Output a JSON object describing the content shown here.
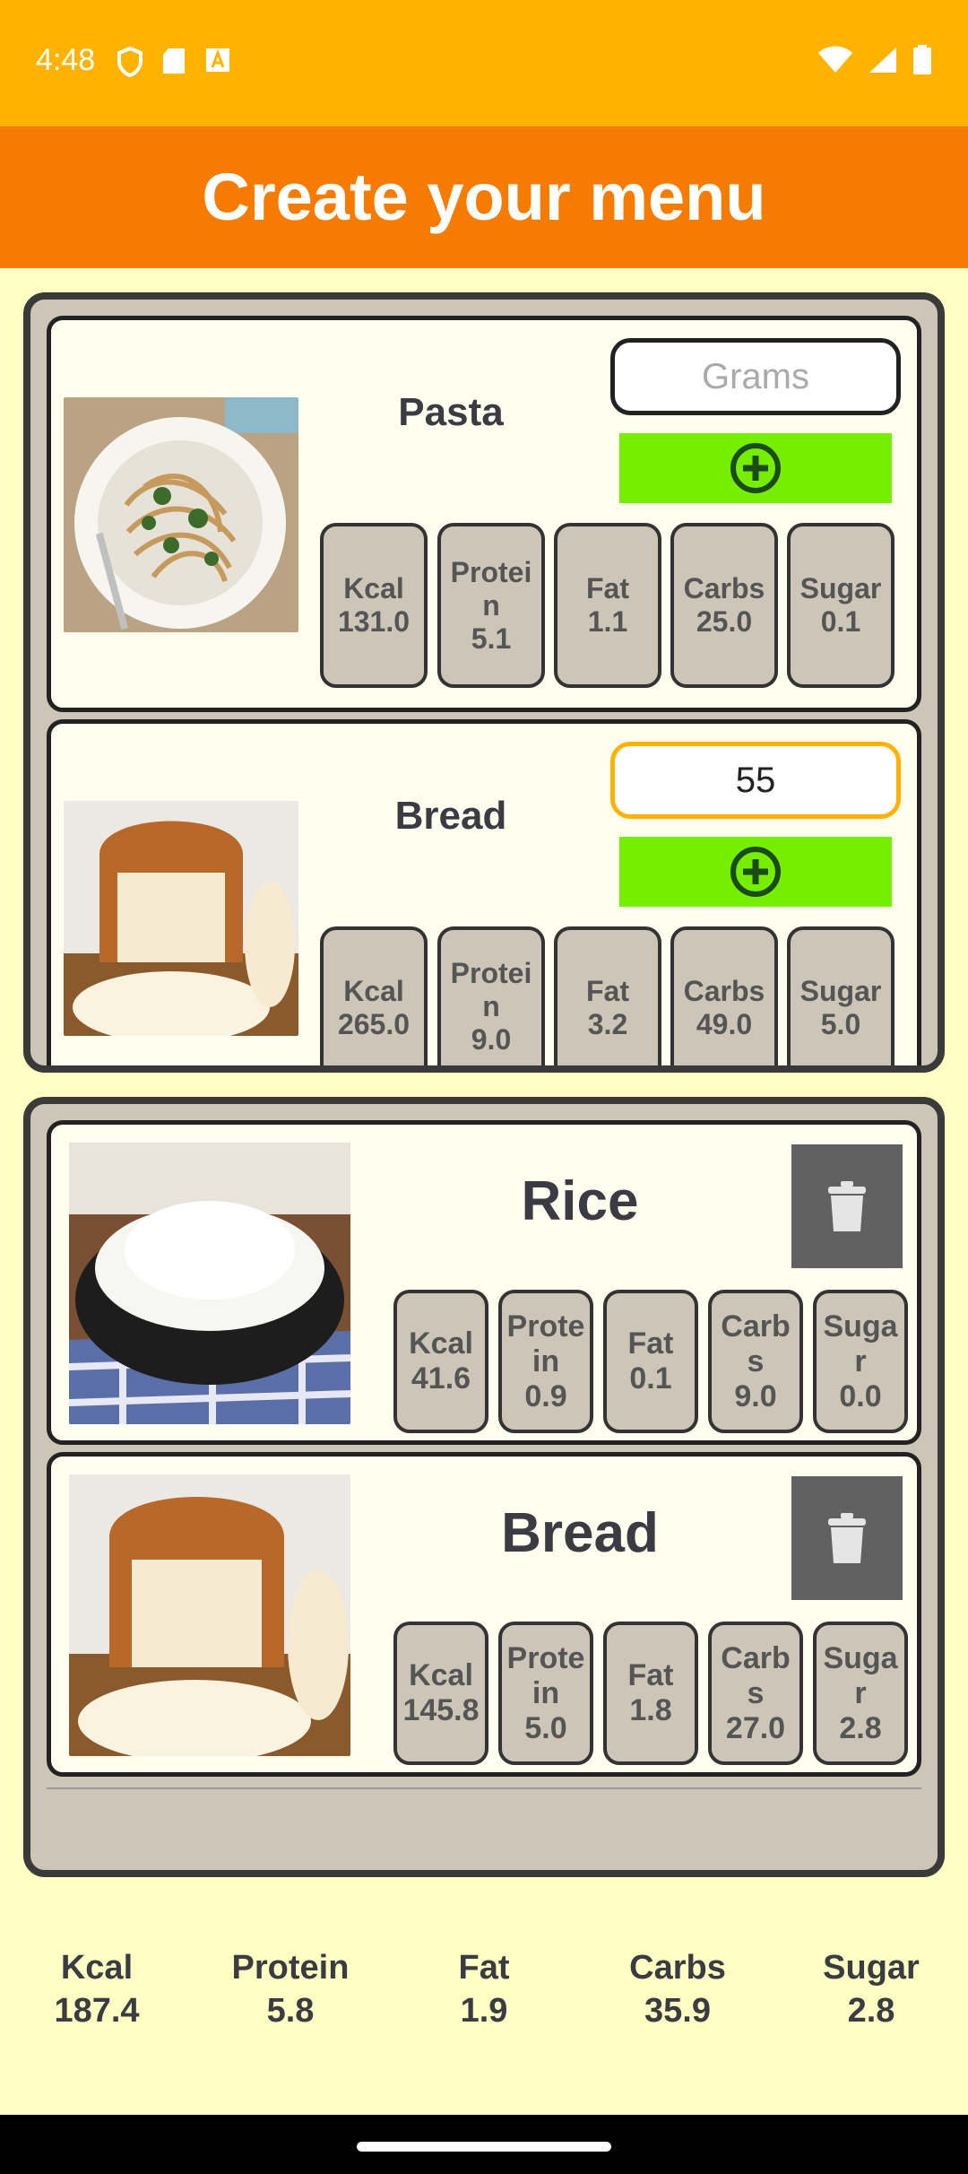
{
  "status": {
    "time": "4:48"
  },
  "app": {
    "title": "Create your menu"
  },
  "catalog": [
    {
      "name": "Pasta",
      "grams_value": "",
      "grams_placeholder": "Grams",
      "nutrients": [
        {
          "label": "Kcal",
          "value": "131.0"
        },
        {
          "label": "Protein",
          "value": "5.1"
        },
        {
          "label": "Fat",
          "value": "1.1"
        },
        {
          "label": "Carbs",
          "value": "25.0"
        },
        {
          "label": "Sugar",
          "value": "0.1"
        }
      ]
    },
    {
      "name": "Bread",
      "grams_value": "55",
      "grams_placeholder": "Grams",
      "nutrients": [
        {
          "label": "Kcal",
          "value": "265.0"
        },
        {
          "label": "Protein",
          "value": "9.0"
        },
        {
          "label": "Fat",
          "value": "3.2"
        },
        {
          "label": "Carbs",
          "value": "49.0"
        },
        {
          "label": "Sugar",
          "value": "5.0"
        }
      ]
    }
  ],
  "menu": [
    {
      "name": "Rice",
      "nutrients": [
        {
          "label": "Kcal",
          "value": "41.6"
        },
        {
          "label": "Protein",
          "value": "0.9"
        },
        {
          "label": "Fat",
          "value": "0.1"
        },
        {
          "label": "Carbs",
          "value": "9.0"
        },
        {
          "label": "Sugar",
          "value": "0.0"
        }
      ]
    },
    {
      "name": "Bread",
      "nutrients": [
        {
          "label": "Kcal",
          "value": "145.8"
        },
        {
          "label": "Protein",
          "value": "5.0"
        },
        {
          "label": "Fat",
          "value": "1.8"
        },
        {
          "label": "Carbs",
          "value": "27.0"
        },
        {
          "label": "Sugar",
          "value": "2.8"
        }
      ]
    }
  ],
  "totals": [
    {
      "label": "Kcal",
      "value": "187.4"
    },
    {
      "label": "Protein",
      "value": "5.8"
    },
    {
      "label": "Fat",
      "value": "1.9"
    },
    {
      "label": "Carbs",
      "value": "35.9"
    },
    {
      "label": "Sugar",
      "value": "2.8"
    }
  ],
  "icons": {
    "add": "add-circle-icon",
    "delete": "trash-icon"
  },
  "colors": {
    "status_bar": "#ffb300",
    "app_bar": "#f57c00",
    "add_button": "#76ee00",
    "delete_button": "#616161",
    "background": "#ffffc4"
  }
}
